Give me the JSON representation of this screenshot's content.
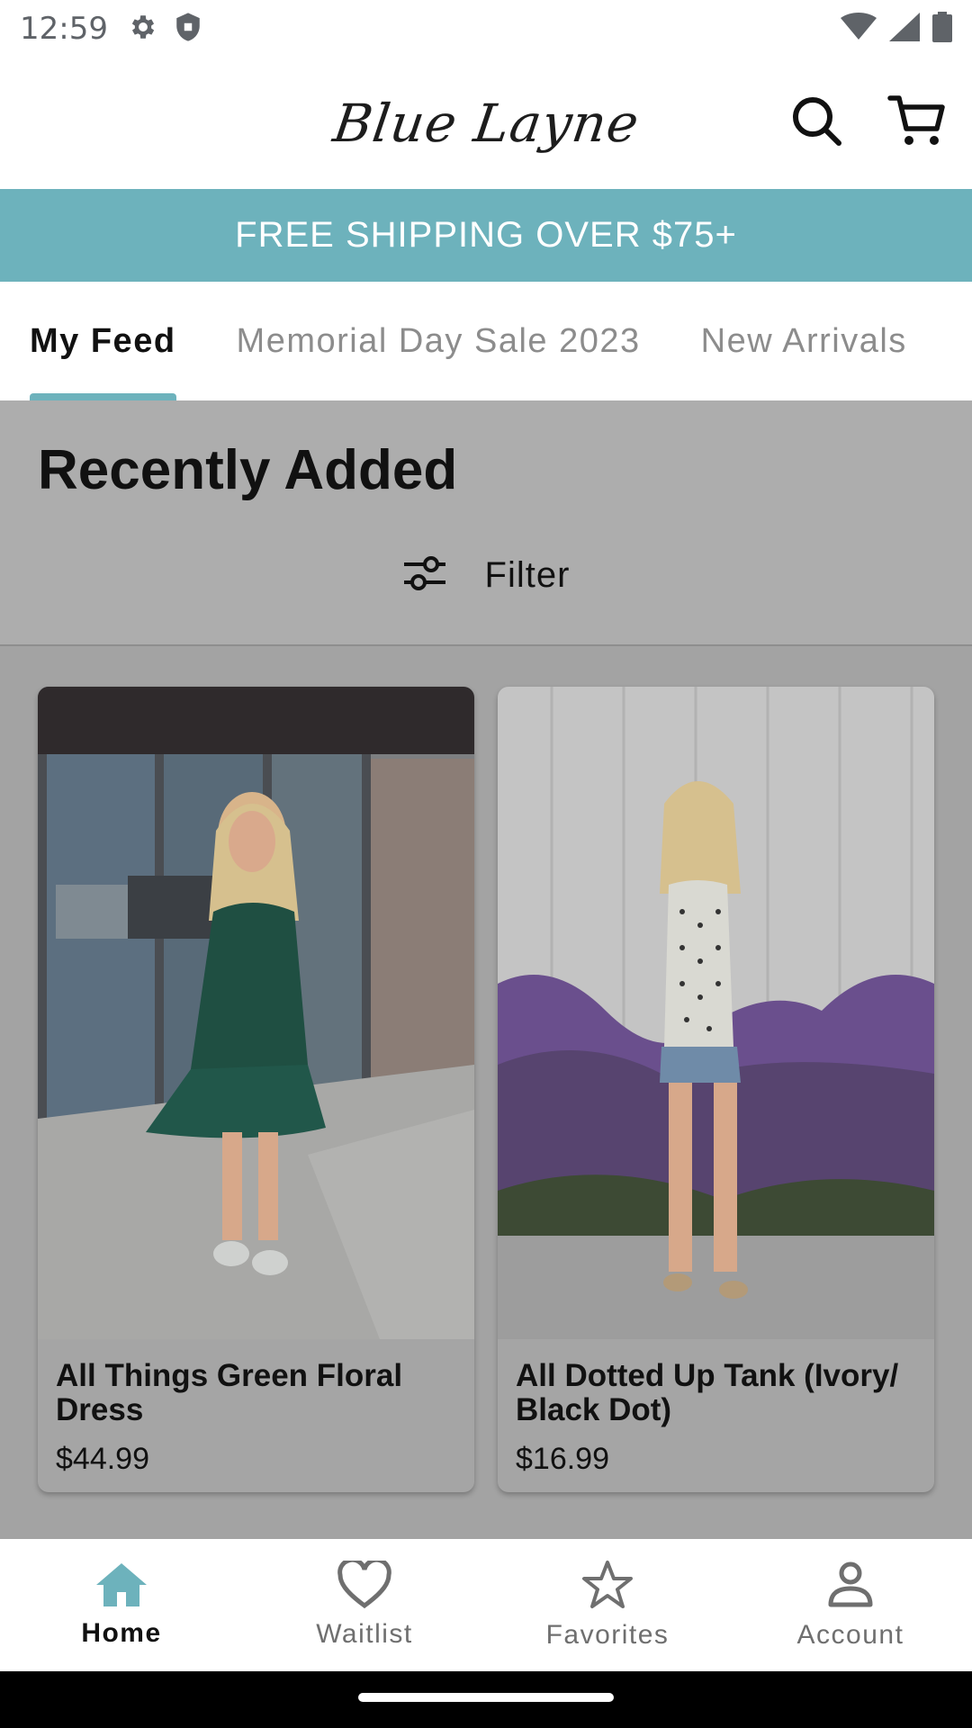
{
  "status_bar": {
    "time": "12:59"
  },
  "header": {
    "logo_text": "Blue Layne"
  },
  "banner": {
    "text": "FREE SHIPPING OVER $75+"
  },
  "tabs": [
    {
      "label": "My Feed"
    },
    {
      "label": "Memorial Day Sale 2023"
    },
    {
      "label": "New Arrivals"
    }
  ],
  "section": {
    "title": "Recently Added",
    "filter_label": "Filter"
  },
  "products": [
    {
      "name": "All Things Green Floral Dress",
      "price": "$44.99"
    },
    {
      "name": "All Dotted Up Tank (Ivory/ Black Dot)",
      "price": "$16.99"
    }
  ],
  "bottom_nav": [
    {
      "label": "Home"
    },
    {
      "label": "Waitlist"
    },
    {
      "label": "Favorites"
    },
    {
      "label": "Account"
    }
  ],
  "colors": {
    "accent": "#6db2bc",
    "overlay": "#a3a3a3"
  }
}
